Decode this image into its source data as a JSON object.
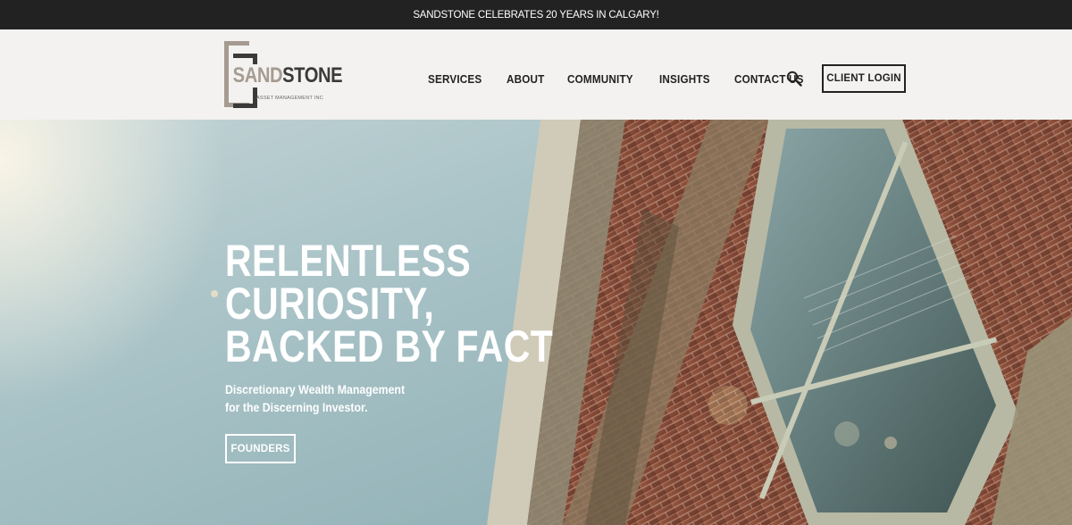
{
  "announcement": {
    "text": "SANDSTONE CELEBRATES 20 YEARS IN CALGARY!"
  },
  "logo": {
    "word_part_1": "SAND",
    "word_part_2": "STONE",
    "tagline": "ASSET MANAGEMENT INC"
  },
  "nav": {
    "items": [
      {
        "label": "SERVICES"
      },
      {
        "label": "ABOUT"
      },
      {
        "label": "COMMUNITY"
      },
      {
        "label": "INSIGHTS"
      },
      {
        "label": "CONTACT US"
      }
    ],
    "search_icon": "search-icon",
    "login_label": "CLIENT LOGIN"
  },
  "hero": {
    "title_lines": [
      "RELENTLESS",
      "CURIOSITY,",
      "BACKED BY FACT"
    ],
    "subtitle_lines": [
      "Discretionary Wealth Management",
      "for the Discerning Investor."
    ],
    "button_label": "FOUNDERS"
  },
  "colors": {
    "topbar_bg": "#222222",
    "header_bg": "#f3f2f0",
    "logo_light": "#a59b91",
    "logo_dark": "#3c3a39",
    "sky": "#a9c3c7",
    "brick": "#8a4a35"
  }
}
